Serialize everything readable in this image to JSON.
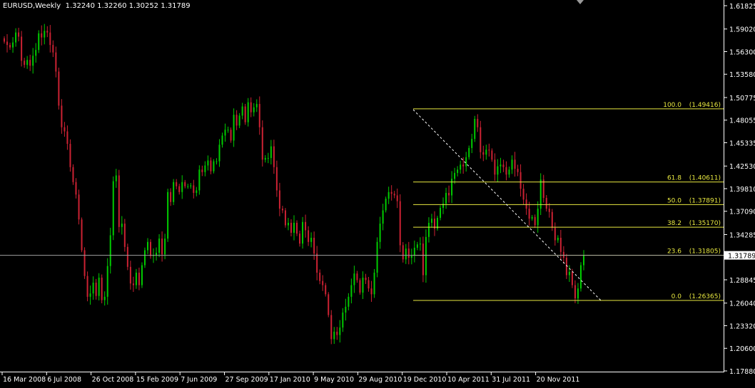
{
  "header": {
    "symbol": "EURUSD,Weekly",
    "open": "1.32240",
    "high": "1.32260",
    "low": "1.30252",
    "close": "1.31789"
  },
  "colors": {
    "background": "#000000",
    "bull_candle": "#00cc00",
    "bear_candle": "#cc2233",
    "axis": "#ffffff",
    "fibo": "#e8e840",
    "trend_line": "#ffffff",
    "price_line": "#a0a0a0"
  },
  "price_axis": {
    "labels": [
      "1.61825",
      "1.59020",
      "1.56300",
      "1.53580",
      "1.50775",
      "1.48055",
      "1.45335",
      "1.42530",
      "1.39810",
      "1.37090",
      "1.34285",
      "1.31789",
      "1.28845",
      "1.26040",
      "1.23320",
      "1.20600",
      "1.17880"
    ],
    "current_price": "1.31789"
  },
  "time_axis": {
    "labels": [
      "16 Mar 2008",
      "6 Jul 2008",
      "26 Oct 2008",
      "15 Feb 2009",
      "7 Jun 2009",
      "27 Sep 2009",
      "17 Jan 2010",
      "9 May 2010",
      "29 Aug 2010",
      "19 Dec 2010",
      "10 Apr 2011",
      "31 Jul 2011",
      "20 Nov 2011"
    ]
  },
  "fibonacci": {
    "levels": [
      {
        "ratio": "100.0",
        "price": "(1.49416)",
        "value": 1.49416
      },
      {
        "ratio": "61.8",
        "price": "(1.40611)",
        "value": 1.40611
      },
      {
        "ratio": "50.0",
        "price": "(1.37891)",
        "value": 1.37891
      },
      {
        "ratio": "38.2",
        "price": "(1.35170)",
        "value": 1.3517
      },
      {
        "ratio": "23.6",
        "price": "(1.31805)",
        "value": 1.31805
      },
      {
        "ratio": "0.0",
        "price": "(1.26365)",
        "value": 1.26365
      }
    ]
  },
  "chart_data": {
    "type": "candlestick",
    "title": "",
    "timeframe": "Weekly",
    "x_start": "16 Mar 2008",
    "x_end": "20 Nov 2011",
    "ylim": [
      1.1788,
      1.61825
    ],
    "grid": false,
    "weekly_closes": [
      1.575,
      1.571,
      1.568,
      1.574,
      1.586,
      1.581,
      1.552,
      1.547,
      1.553,
      1.546,
      1.558,
      1.565,
      1.585,
      1.58,
      1.588,
      1.586,
      1.571,
      1.562,
      1.539,
      1.498,
      1.472,
      1.467,
      1.452,
      1.424,
      1.406,
      1.391,
      1.361,
      1.324,
      1.293,
      1.268,
      1.272,
      1.285,
      1.269,
      1.291,
      1.264,
      1.268,
      1.305,
      1.342,
      1.407,
      1.414,
      1.352,
      1.356,
      1.328,
      1.304,
      1.284,
      1.282,
      1.297,
      1.282,
      1.306,
      1.324,
      1.334,
      1.317,
      1.318,
      1.321,
      1.338,
      1.319,
      1.338,
      1.394,
      1.382,
      1.406,
      1.401,
      1.394,
      1.406,
      1.401,
      1.401,
      1.402,
      1.393,
      1.396,
      1.421,
      1.418,
      1.426,
      1.432,
      1.419,
      1.431,
      1.431,
      1.451,
      1.462,
      1.469,
      1.469,
      1.456,
      1.487,
      1.474,
      1.486,
      1.497,
      1.478,
      1.502,
      1.49,
      1.496,
      1.5,
      1.472,
      1.433,
      1.435,
      1.435,
      1.449,
      1.424,
      1.396,
      1.374,
      1.372,
      1.354,
      1.357,
      1.345,
      1.357,
      1.344,
      1.332,
      1.358,
      1.348,
      1.334,
      1.339,
      1.32,
      1.297,
      1.287,
      1.282,
      1.271,
      1.246,
      1.217,
      1.226,
      1.222,
      1.231,
      1.249,
      1.256,
      1.268,
      1.282,
      1.296,
      1.288,
      1.273,
      1.291,
      1.288,
      1.278,
      1.271,
      1.297,
      1.334,
      1.356,
      1.372,
      1.386,
      1.394,
      1.392,
      1.39,
      1.383,
      1.33,
      1.313,
      1.326,
      1.315,
      1.318,
      1.327,
      1.331,
      1.332,
      1.294,
      1.34,
      1.357,
      1.362,
      1.35,
      1.363,
      1.375,
      1.38,
      1.393,
      1.39,
      1.41,
      1.417,
      1.421,
      1.427,
      1.425,
      1.436,
      1.447,
      1.458,
      1.482,
      1.472,
      1.442,
      1.439,
      1.445,
      1.444,
      1.433,
      1.415,
      1.425,
      1.427,
      1.424,
      1.415,
      1.421,
      1.433,
      1.422,
      1.418,
      1.398,
      1.385,
      1.374,
      1.362,
      1.364,
      1.354,
      1.374,
      1.409,
      1.387,
      1.374,
      1.37,
      1.351,
      1.336,
      1.339,
      1.322,
      1.315,
      1.294,
      1.298,
      1.282,
      1.266,
      1.278,
      1.306,
      1.318
    ]
  }
}
